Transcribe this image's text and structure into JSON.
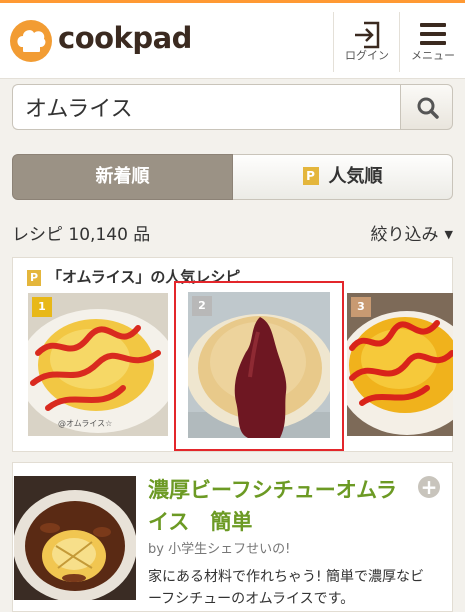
{
  "header": {
    "logo_text": "cookpad",
    "login_label": "ログイン",
    "menu_label": "メニュー"
  },
  "search": {
    "value": "オムライス",
    "placeholder": ""
  },
  "sort_tabs": [
    {
      "label": "新着順",
      "selected": true
    },
    {
      "label": "人気順",
      "selected": false,
      "badge": "P"
    }
  ],
  "results": {
    "count_text": "レシピ 10,140 品",
    "filter_label": "絞り込み"
  },
  "popular": {
    "badge": "P",
    "title": "「オムライス」の人気レシピ",
    "items": [
      {
        "rank": "1",
        "rank_color": "#e8b818",
        "caption": "@オムライス☆"
      },
      {
        "rank": "2",
        "rank_color": "#b8b8b8"
      },
      {
        "rank": "3",
        "rank_color": "#c89a72"
      }
    ]
  },
  "recipe": {
    "title": "濃厚ビーフシチューオムライス　簡単",
    "author": "by 小学生シェフせいの!",
    "description": "家にある材料で作れちゃう! 簡単で濃厚なビーフシチューのオムライスです。",
    "add_symbol": "+"
  },
  "colors": {
    "accent": "#ff9933",
    "title_green": "#6c9a24",
    "tab_selected": "#9b9285",
    "highlight": "#e3262b"
  }
}
